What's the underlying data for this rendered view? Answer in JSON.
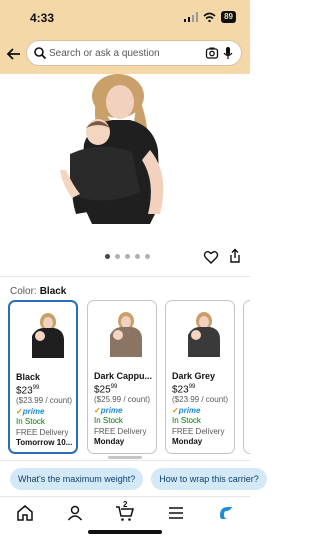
{
  "status": {
    "time": "4:33",
    "battery": "89"
  },
  "header": {
    "search_placeholder": "Search or ask a question"
  },
  "color_select": {
    "label": "Color:",
    "value": "Black"
  },
  "gallery": {
    "dots": 5,
    "active_index": 0
  },
  "variants": [
    {
      "name": "Black",
      "price_whole": "$23",
      "price_frac": "99",
      "unit_price": "($23.99 / count)",
      "prime": "prime",
      "stock": "In Stock",
      "delivery": "FREE Delivery",
      "day": "Tomorrow 10...",
      "selected": true,
      "color": "#222222"
    },
    {
      "name": "Dark Cappu...",
      "price_whole": "$25",
      "price_frac": "99",
      "unit_price": "($25.99 / count)",
      "prime": "prime",
      "stock": "In Stock",
      "delivery": "FREE Delivery",
      "day": "Monday",
      "selected": false,
      "color": "#8a7564"
    },
    {
      "name": "Dark Grey",
      "price_whole": "$23",
      "price_frac": "99",
      "unit_price": "($23.99 / count)",
      "prime": "prime",
      "stock": "In Stock",
      "delivery": "FREE Delivery",
      "day": "Monday",
      "selected": false,
      "color": "#3a3a3a"
    }
  ],
  "chips": [
    "What's the maximum weight?",
    "How to wrap this carrier?"
  ],
  "bottom_nav": {
    "cart_count": "2"
  },
  "colors": {
    "header_bg": "#f5d8a8",
    "selected_border": "#2a6ebb",
    "in_stock": "#007600",
    "prime": "#1f8dd6",
    "chip_bg": "#d4e9f7"
  }
}
